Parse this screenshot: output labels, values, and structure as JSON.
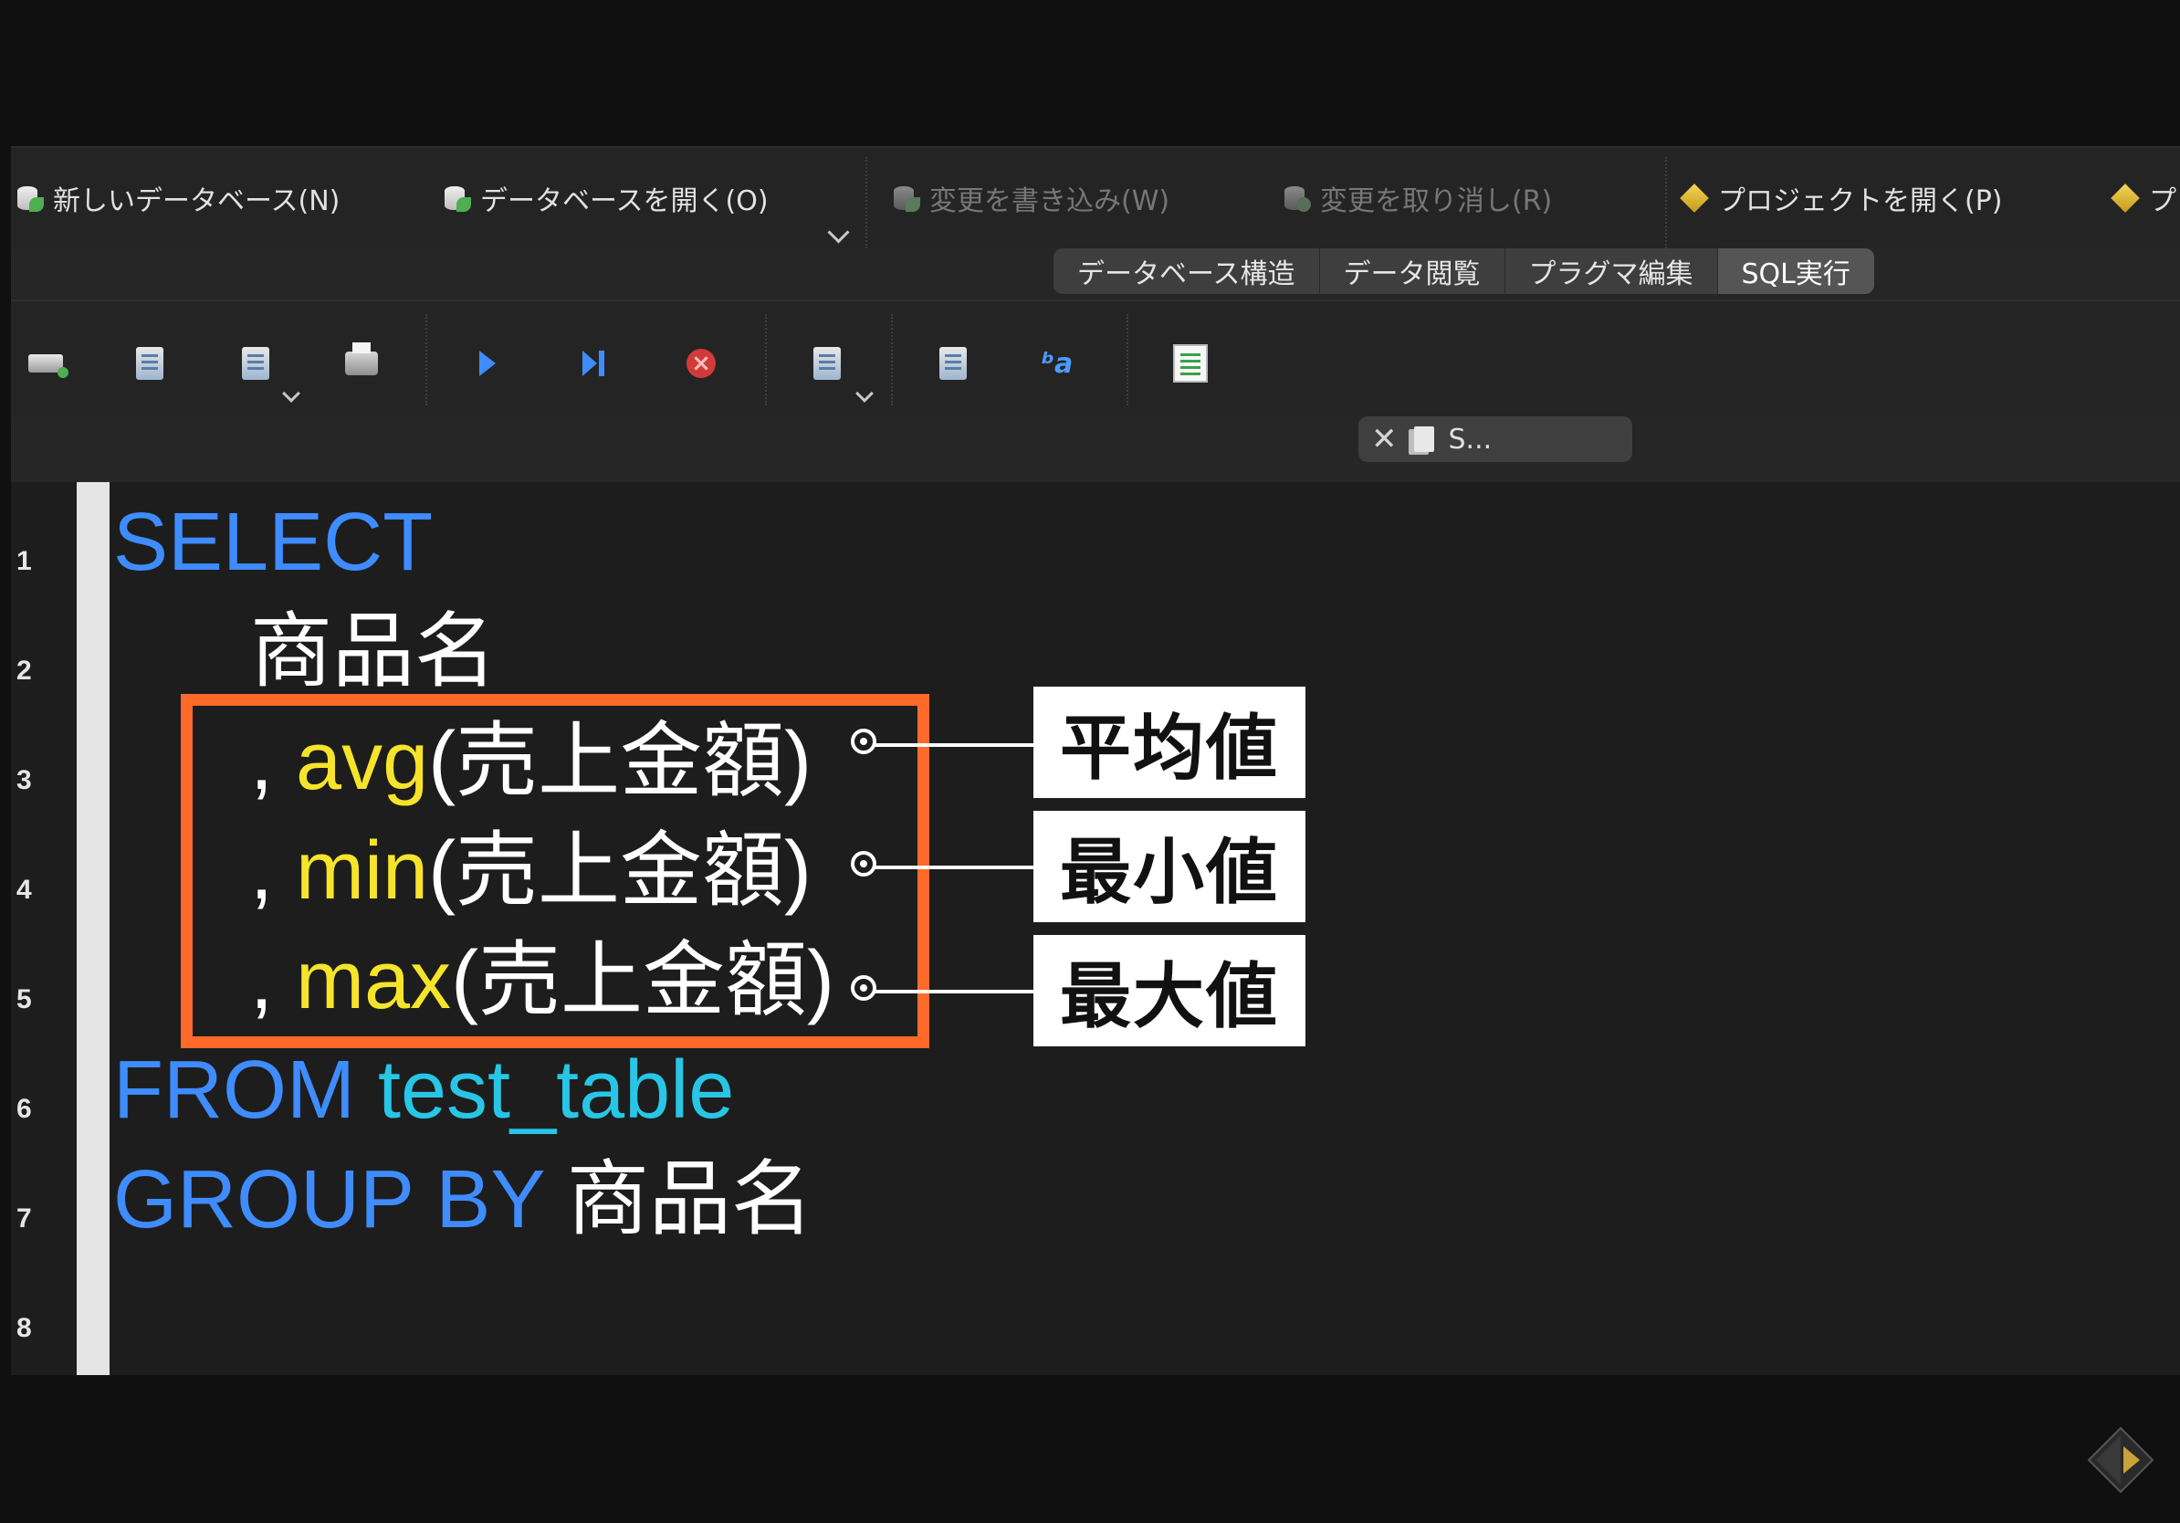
{
  "toolbar": {
    "new_db": "新しいデータベース(N)",
    "open_db": "データベースを開く(O)",
    "write_changes": "変更を書き込み(W)",
    "revert_changes": "変更を取り消し(R)",
    "open_project": "プロジェクトを開く(P)",
    "overflow": "プ"
  },
  "tabs": [
    {
      "label": "データベース構造",
      "active": false
    },
    {
      "label": "データ閲覧",
      "active": false
    },
    {
      "label": "プラグマ編集",
      "active": false
    },
    {
      "label": "SQL実行",
      "active": true
    }
  ],
  "sql_toolbar_icons": [
    "open-tab-icon",
    "open-sql-file-icon",
    "save-sql-file-icon",
    "print-icon",
    "execute-all-icon",
    "execute-current-line-icon",
    "stop-execution-icon",
    "save-results-icon",
    "find-icon",
    "find-replace-icon",
    "comment-icon"
  ],
  "query_tab": {
    "label": "S...",
    "close_glyph": "✕"
  },
  "editor": {
    "line_numbers": [
      "1",
      "2",
      "3",
      "4",
      "5",
      "6",
      "7",
      "8"
    ],
    "lines": {
      "l1": {
        "kw": "SELECT"
      },
      "l2": {
        "text": "商品名"
      },
      "l3": {
        "comma": ",",
        "fn": "avg",
        "args": "(売上金額)"
      },
      "l4": {
        "comma": ",",
        "fn": "min",
        "args": "(売上金額)"
      },
      "l5": {
        "comma": ",",
        "fn": "max",
        "args": "(売上金額)"
      },
      "l6": {
        "kw": "FROM",
        "table": "test_table"
      },
      "l7": {
        "kw": "GROUP BY",
        "text": "商品名"
      }
    }
  },
  "callouts": [
    "平均値",
    "最小値",
    "最大値"
  ],
  "colors": {
    "keyword": "#3f8cff",
    "table": "#28c6e6",
    "function": "#f5e42a",
    "highlight": "#ff6a2a"
  }
}
